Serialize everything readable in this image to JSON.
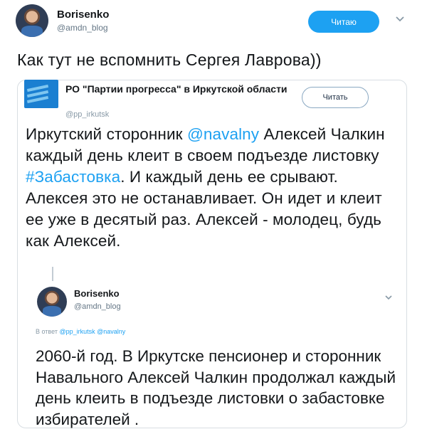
{
  "top_tweet": {
    "author_name": "Borisenko",
    "author_handle": "@amdn_blog",
    "follow_label": "Читаю",
    "text": "Как тут не вспомнить Сергея Лаврова))"
  },
  "quoted_tweet": {
    "author_name": "РО \"Партии прогресса\" в Иркутской области",
    "author_handle": "@pp_irkutsk",
    "follow_label": "Читать",
    "text_part1": "Иркутский сторонник ",
    "mention": "@navalny",
    "text_part2": " Алексей Чалкин каждый день клеит в своем подъезде листовку ",
    "hashtag": "#Забастовка",
    "text_part3": ". И каждый день ее срывают. Алексея это не останавливает. Он идет и клеит ее уже в десятый раз. Алексей - молодец, будь как Алексей."
  },
  "reply_tweet": {
    "author_name": "Borisenko",
    "author_handle": "@amdn_blog",
    "in_reply_prefix": "В ответ",
    "in_reply_handles": "@pp_irkutsk @navalny",
    "text": "2060-й год. В Иркутске пенсионер и сторонник Навального Алексей Чалкин продолжал каждый день клеить в подъезде листовки о забастовке избирателей ."
  },
  "colors": {
    "accent": "#1da1f2",
    "text": "#14171a",
    "muted": "#657786"
  }
}
